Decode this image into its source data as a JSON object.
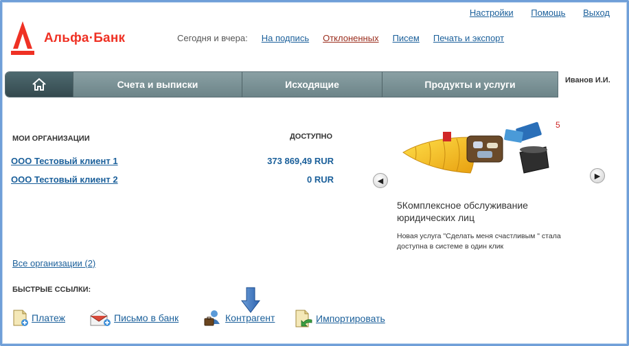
{
  "top_links": {
    "settings": "Настройки",
    "help": "Помощь",
    "logout": "Выход"
  },
  "logo": {
    "text": "Альфа·Банк"
  },
  "today": {
    "label": "Сегодня и вчера:",
    "links": [
      "На подпись",
      "Отклоненных",
      "Писем",
      "Печать и экспорт"
    ]
  },
  "nav": {
    "accounts": "Счета и выписки",
    "outgoing": "Исходящие",
    "products": "Продукты и услуги"
  },
  "user": {
    "name": "Иванов И.И."
  },
  "orgs": {
    "title": "МОИ ОРГАНИЗАЦИИ",
    "available": "ДОСТУПНО",
    "rows": [
      {
        "name": "ООО Тестовый клиент 1",
        "amount": "373 869,49 RUR"
      },
      {
        "name": "ООО Тестовый клиент 2",
        "amount": "0 RUR"
      }
    ],
    "all_link": "Все организации (2)"
  },
  "quick": {
    "title": "БЫСТРЫЕ ССЫЛКИ:",
    "payment": "Платеж",
    "letter": "Письмо в банк",
    "counterparty": "Контрагент",
    "import": "Импортировать"
  },
  "promo": {
    "counter": "5",
    "title": "5Комплексное обслуживание юридических лиц",
    "description": "Новая услуга \"Сделать меня счастливым \" стала доступна в системе в один клик",
    "prev": "◀",
    "next": "▶"
  },
  "colors": {
    "brand": "#ef3124",
    "link": "#1a5f9a",
    "nav": "#7b9296"
  }
}
